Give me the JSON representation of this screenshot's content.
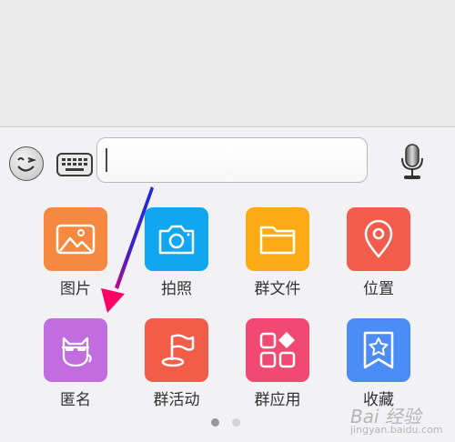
{
  "input": {
    "value": "",
    "placeholder": ""
  },
  "icons": {
    "emoji": "smiley-face-icon",
    "keyboard": "keyboard-icon",
    "microphone": "microphone-icon"
  },
  "apps": [
    {
      "label": "图片",
      "icon": "image-icon",
      "color": "#f5893f"
    },
    {
      "label": "拍照",
      "icon": "camera-icon",
      "color": "#10a7f0"
    },
    {
      "label": "群文件",
      "icon": "folder-icon",
      "color": "#fbac14"
    },
    {
      "label": "位置",
      "icon": "location-pin-icon",
      "color": "#f25c4c"
    },
    {
      "label": "匿名",
      "icon": "cat-mask-icon",
      "color": "#c16de0"
    },
    {
      "label": "群活动",
      "icon": "flag-icon",
      "color": "#f25d4a"
    },
    {
      "label": "群应用",
      "icon": "apps-grid-icon",
      "color": "#f04a72"
    },
    {
      "label": "收藏",
      "icon": "bookmark-star-icon",
      "color": "#4b8cf5"
    }
  ],
  "pager": {
    "pages": 2,
    "current": 1
  },
  "watermark": {
    "brand": "Bai 经验",
    "url": "jingyan.baidu.com"
  },
  "annotation": {
    "arrow_color": "#ff0066"
  }
}
